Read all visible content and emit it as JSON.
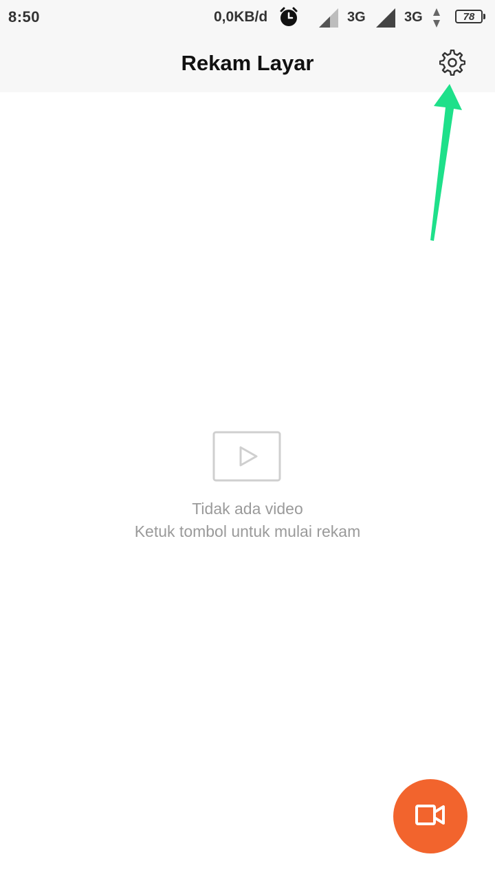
{
  "status_bar": {
    "time": "8:50",
    "network_speed": "0,0KB/d",
    "alarm_icon": "alarm-clock-icon",
    "sim1_network": "3G",
    "sim2_network": "3G",
    "battery_level": "78"
  },
  "app_bar": {
    "title": "Rekam Layar",
    "settings_icon": "gear-icon"
  },
  "empty_state": {
    "icon": "video-play-icon",
    "title": "Tidak ada video",
    "subtitle": "Ketuk tombol untuk mulai rekam"
  },
  "fab": {
    "icon": "video-camera-icon",
    "color": "#f2642d"
  },
  "annotation": {
    "arrow_color": "#1ee08a"
  }
}
